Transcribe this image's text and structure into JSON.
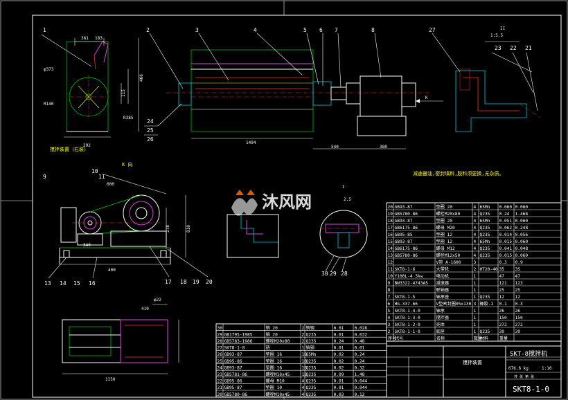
{
  "watermark": {
    "text": "沐风网",
    "logo": "mf-logo-icon"
  },
  "view_labels": {
    "side_view": "搅拌装置（右装）",
    "view_k": "K 向",
    "view_i": "I",
    "scale_i": "1:2.5",
    "view_ii": "II",
    "scale_ii": "1:5.5",
    "arrow_k": "K"
  },
  "tech_note": "减速器油,密封填料,胶料须更换,无杂质。",
  "callouts_top": [
    "1",
    "2",
    "3",
    "4",
    "5",
    "6",
    "7",
    "8",
    "27"
  ],
  "callouts_left": [
    "24",
    "25",
    "26"
  ],
  "callouts_detail": [
    "23",
    "22",
    "21"
  ],
  "callouts_kview": [
    "9",
    "10",
    "11"
  ],
  "callouts_kview_bottom": [
    "13",
    "14",
    "15",
    "16",
    "17",
    "18",
    "19",
    "20"
  ],
  "callouts_mid_detail": [
    "30",
    "29",
    "28"
  ],
  "dimensions": {
    "d1": "361",
    "d2": "183",
    "d3": "φ373",
    "d4": "R140",
    "d5": "292",
    "d6": "466",
    "d7": "115",
    "d8": "R385",
    "d9": "1494",
    "d10": "540",
    "d11": "380",
    "d12": "600",
    "d13": "340",
    "d14": "400",
    "d15": "810",
    "d16": "278",
    "d17": "410",
    "d18": "1150",
    "d19": "φ22",
    "d20": "2.5"
  },
  "bom_right": [
    {
      "no": "20",
      "code": "GB93-87",
      "name": "垫圈 20",
      "qty": "4",
      "mat": "65Mn",
      "w1": "0.060",
      "w2": "0.060"
    },
    {
      "no": "19",
      "code": "GB5780-86",
      "name": "螺栓M20x80",
      "qty": "4",
      "mat": "Q235",
      "w1": "0.24",
      "w2": "1.468"
    },
    {
      "no": "18",
      "code": "GB93-87",
      "name": "垫圈 20",
      "qty": "4",
      "mat": "65Mn",
      "w1": "0.051",
      "w2": "0.060"
    },
    {
      "no": "17",
      "code": "GB6175-86",
      "name": "螺母 M20",
      "qty": "4",
      "mat": "Q235",
      "w1": "0.062",
      "w2": "0.248"
    },
    {
      "no": "16",
      "code": "GB95-85",
      "name": "垫圈 12",
      "qty": "4",
      "mat": "Q235",
      "w1": "0.014",
      "w2": "0.056"
    },
    {
      "no": "15",
      "code": "GB93-87",
      "name": "垫圈 12",
      "qty": "4",
      "mat": "65Mn",
      "w1": "0.015",
      "w2": "0.060"
    },
    {
      "no": "14",
      "code": "GB6175-86",
      "name": "螺母 M12",
      "qty": "4",
      "mat": "Q235",
      "w1": "0.041",
      "w2": "0.048"
    },
    {
      "no": "13",
      "code": "GB5780-86",
      "name": "螺栓M12x50",
      "qty": "4",
      "mat": "Q235",
      "w1": "0.015",
      "w2": "0.060"
    },
    {
      "no": "12",
      "code": "",
      "name": "V带 A-1600",
      "qty": "3",
      "mat": "",
      "w1": "0.3",
      "w2": "0.9"
    },
    {
      "no": "11",
      "code": "SKT8-1-6",
      "name": "大带轮",
      "qty": "2",
      "mat": "HT20-40",
      "w1": "35",
      "w2": "35"
    },
    {
      "no": "10",
      "code": "Y100L-4 3kw",
      "name": "电动机",
      "qty": "1",
      "mat": "",
      "w1": "47",
      "w2": "47"
    },
    {
      "no": "9",
      "code": "BW3322-4743A5",
      "name": "减速器",
      "qty": "1",
      "mat": "",
      "w1": "121",
      "w2": "123"
    },
    {
      "no": "8",
      "code": "",
      "name": "联轴器",
      "qty": "1",
      "mat": "",
      "w1": "25",
      "w2": "25"
    },
    {
      "no": "7",
      "code": "SKT8-1-5",
      "name": "轴承座",
      "qty": "1",
      "mat": "Q235",
      "w1": "12",
      "w2": "12"
    },
    {
      "no": "6",
      "code": "HG-337-66",
      "name": "V型密封圈05x130",
      "qty": "3",
      "mat": "橡胶-I",
      "w1": "0.1",
      "w2": "0.3"
    },
    {
      "no": "5",
      "code": "SKT8-1-4-0",
      "name": "轴承",
      "qty": "1",
      "mat": "",
      "w1": "26",
      "w2": "26"
    },
    {
      "no": "4",
      "code": "SKT8-1-3-0",
      "name": "搅拌器",
      "qty": "1",
      "mat": "",
      "w1": "150",
      "w2": "150"
    },
    {
      "no": "3",
      "code": "SKT8-1-2-0",
      "name": "壳体",
      "qty": "1",
      "mat": "",
      "w1": "272",
      "w2": "272"
    },
    {
      "no": "2",
      "code": "SKT8-1-1-0",
      "name": "底座",
      "qty": "1",
      "mat": "Q235",
      "w1": "39",
      "w2": "39"
    }
  ],
  "bom_right_header": {
    "no": "序号",
    "code": "代号",
    "name": "名称",
    "qty": "数量",
    "mat": "材料",
    "w": "重量"
  },
  "bom_left": [
    {
      "no": "30",
      "code": "",
      "name": "销 20",
      "qty": "2",
      "mat": "销钢",
      "w1": "0.01",
      "w2": "0.028"
    },
    {
      "no": "29",
      "code": "GB1795-1985",
      "name": "销 20",
      "qty": "2",
      "mat": "Q235",
      "w1": "0.01",
      "w2": "0.032"
    },
    {
      "no": "28",
      "code": "GB5783-1986",
      "name": "螺栓M20x80",
      "qty": "2",
      "mat": "Q235",
      "w1": "0.24",
      "w2": "0.48"
    },
    {
      "no": "27",
      "code": "SKT8-1-8",
      "name": "链",
      "qty": "1",
      "mat": "销钢",
      "w1": "0.01",
      "w2": "0.01"
    },
    {
      "no": "26",
      "code": "GB93-87",
      "name": "垫圈 16",
      "qty": "16",
      "mat": "65Mn",
      "w1": "0.02",
      "w2": "0.24"
    },
    {
      "no": "25",
      "code": "GB95-86",
      "name": "垫圈 16",
      "qty": "16",
      "mat": "Q235",
      "w1": "0.02",
      "w2": "0.24"
    },
    {
      "no": "24",
      "code": "GB93-87",
      "name": "垫圈 16",
      "qty": "16",
      "mat": "Q235",
      "w1": "0.02",
      "w2": "0.32"
    },
    {
      "no": "23",
      "code": "GB5781-86",
      "name": "螺栓M16x45",
      "qty": "16",
      "mat": "Q235",
      "w1": "0.09",
      "w2": "1.48"
    },
    {
      "no": "22",
      "code": "GB95-86",
      "name": "螺母 M10",
      "qty": "4",
      "mat": "Q235",
      "w1": "0.01",
      "w2": "0.044"
    },
    {
      "no": "21",
      "code": "GB95-87",
      "name": "垫圈 10",
      "qty": "4",
      "mat": "Q235",
      "w1": "0.01",
      "w2": "0.044"
    },
    {
      "no": "20",
      "code": "GB5780-86",
      "name": "螺栓M10x45",
      "qty": "4",
      "mat": "Q235",
      "w1": "0.03",
      "w2": "0.12"
    }
  ],
  "title_block": {
    "title": "搅拌装置",
    "drawing_no": "SKT8-1-0",
    "drawing_no_small": "SKT-8搅拌机",
    "weight": "676.6 kg",
    "scale": "1:10",
    "sheet": "共 张 第 张"
  }
}
